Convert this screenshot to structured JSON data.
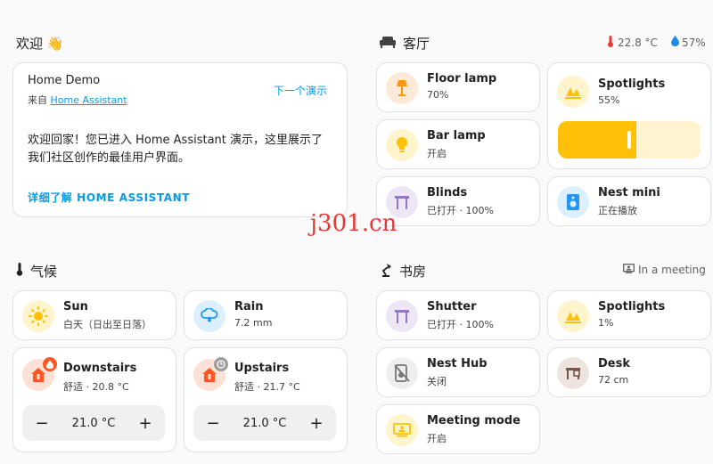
{
  "welcome": {
    "section_title": "欢迎 👋",
    "card_title": "Home Demo",
    "from_prefix": "来自 ",
    "from_link": "Home Assistant",
    "next_demo": "下一个演示",
    "body": "欢迎回家！您已进入 Home Assistant 演示，这里展示了我们社区创作的最佳用户界面。",
    "learn_more": "详细了解 HOME ASSISTANT"
  },
  "living_room": {
    "section_title": "客厅",
    "temperature": "22.8 °C",
    "humidity": "57%",
    "tiles": [
      {
        "name": "Floor lamp",
        "state": "70%"
      },
      {
        "name": "Spotlights",
        "state": "55%",
        "level_percent": 55
      },
      {
        "name": "Bar lamp",
        "state": "开启"
      },
      {
        "name": "Blinds",
        "state": "已打开 · 100%"
      },
      {
        "name": "Nest mini",
        "state": "正在播放"
      }
    ]
  },
  "climate": {
    "section_title": "气候",
    "tiles": [
      {
        "name": "Sun",
        "state": "白天（日出至日落）"
      },
      {
        "name": "Rain",
        "state": "7.2 mm"
      },
      {
        "name": "Downstairs",
        "state": "舒适 · 20.8 °C",
        "setpoint": "21.0 °C"
      },
      {
        "name": "Upstairs",
        "state": "舒适 · 21.7 °C",
        "setpoint": "21.0 °C"
      }
    ],
    "minus": "−",
    "plus": "+"
  },
  "study": {
    "section_title": "书房",
    "status": "In a meeting",
    "tiles": [
      {
        "name": "Shutter",
        "state": "已打开 · 100%"
      },
      {
        "name": "Spotlights",
        "state": "1%"
      },
      {
        "name": "Nest Hub",
        "state": "关闭"
      },
      {
        "name": "Desk",
        "state": "72 cm"
      },
      {
        "name": "Meeting mode",
        "state": "开启"
      }
    ]
  },
  "watermark": "j301.cn",
  "colors": {
    "lamp_bg": "#fde9d7",
    "lamp_fg": "#ff9800",
    "yellow_bg": "#fff4cc",
    "yellow_fg": "#ffc107",
    "purple_bg": "#ece6f5",
    "purple_fg": "#9575cd",
    "blue_bg": "#dcefff",
    "blue_fg": "#2196f3",
    "heat_bg": "#fde0d6",
    "heat_fg": "#ff5722",
    "grey_bg": "#eeeeee",
    "grey_fg": "#757575",
    "brown_bg": "#ece4df",
    "brown_fg": "#795548",
    "accent": "#039be5"
  }
}
